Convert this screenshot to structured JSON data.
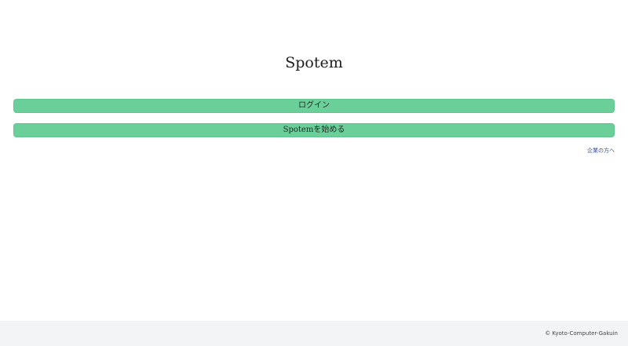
{
  "header": {
    "title": "Spotem"
  },
  "main": {
    "login_label": "ログイン",
    "start_label": "Spotemを始める",
    "business_link_label": "企業の方へ"
  },
  "footer": {
    "copyright_symbol": "©",
    "copyright_text": "Kyoto-Computer-Gakuin"
  },
  "colors": {
    "button_background": "#6bcf99",
    "footer_background": "#f3f4f6",
    "link": "#3a4fa8"
  }
}
